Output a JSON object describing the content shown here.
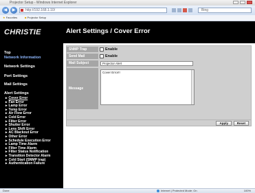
{
  "browser": {
    "title": "Projector Setup - Windows Internet Explorer",
    "address": "http://192.168.1.10/",
    "search_placeholder": "Bing",
    "favorites_label": "Favorites",
    "favorites_item": "Projector Setup",
    "status_left": "Done",
    "status_zone": "Internet | Protected Mode: On",
    "zoom": "100%"
  },
  "sidebar": {
    "logo": "CHRISTIE",
    "top_label": "Top",
    "top_link": "Network Information",
    "links": [
      "Network Settings",
      "Port Settings",
      "Mail Settings",
      "Alert Settings"
    ],
    "alert_items": [
      "Cover Error",
      "Fan Error",
      "Lamp Error",
      "Temp Error",
      "Air Flow Error",
      "Cold Error",
      "Filter Error",
      "Shutter Error",
      "Lens Shift Error",
      "AC Blackout Error",
      "Other Error",
      "Schedule Execution Error",
      "Lamp Time Alarm",
      "Filter Time Alarm",
      "Filter Status Notification",
      "Transition Detector Alarm",
      "Cold Start (SNMP trap)",
      "Authentication Failure"
    ]
  },
  "main": {
    "title": "Alert Settings / Cover Error",
    "snmp_trap_label": "SNMP Trap",
    "snmp_trap_value": "Enable",
    "send_mail_label": "Send Mail",
    "send_mail_value": "Enable",
    "subject_label": "Mail Subject",
    "subject_value": "Projector Alert",
    "message_label": "Message",
    "message_value": "Cover Error!!",
    "apply_button": "Apply",
    "reset_button": "Reset"
  }
}
